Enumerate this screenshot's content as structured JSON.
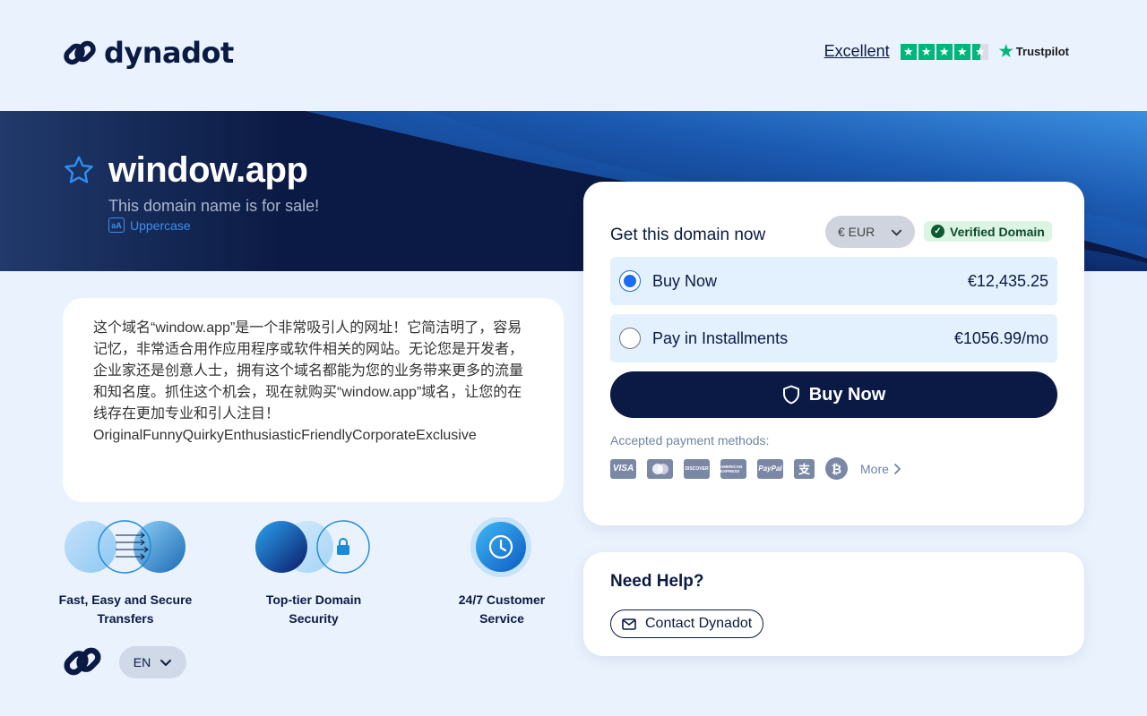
{
  "header": {
    "logo_text": "dynadot",
    "trustpilot_rating_text": "Excellent",
    "trustpilot_brand": "Trustpilot",
    "trustpilot_stars": 4.5
  },
  "hero": {
    "domain": "window.app",
    "subtitle": "This domain name is for sale!",
    "case_toggle": "Uppercase"
  },
  "description": {
    "text": "这个域名“window.app”是一个非常吸引人的网址！它简洁明了，容易记忆，非常适合用作应用程序或软件相关的网站。无论您是开发者，企业家还是创意人士，拥有这个域名都能为您的业务带来更多的流量和知名度。抓住这个机会，现在就购买“window.app”域名，让您的在线存在更加专业和引人注目！",
    "tags": "OriginalFunnyQuirkyEnthusiasticFriendlyCorporateExclusive"
  },
  "features": [
    {
      "label": "Fast, Easy and Secure Transfers"
    },
    {
      "label": "Top-tier Domain Security"
    },
    {
      "label": "24/7 Customer Service"
    }
  ],
  "footer": {
    "language": "EN"
  },
  "purchase": {
    "title": "Get this domain now",
    "currency": "€ EUR",
    "verified_label": "Verified Domain",
    "options": [
      {
        "label": "Buy Now",
        "price": "€12,435.25",
        "selected": true
      },
      {
        "label": "Pay in Installments",
        "price": "€1056.99/mo",
        "selected": false
      }
    ],
    "buy_button": "Buy Now",
    "payment_label": "Accepted payment methods:",
    "payment_methods": [
      "VISA",
      "Mastercard",
      "Discover",
      "American Express",
      "PayPal",
      "Alipay",
      "Bitcoin"
    ],
    "more_label": "More"
  },
  "help": {
    "title": "Need Help?",
    "contact_button": "Contact Dynadot"
  },
  "colors": {
    "navy": "#0b1a44",
    "accent_blue": "#1a6ef5",
    "page_bg": "#eaf2fe",
    "trustpilot_green": "#00b67a",
    "verified_green": "#0d5a33"
  }
}
